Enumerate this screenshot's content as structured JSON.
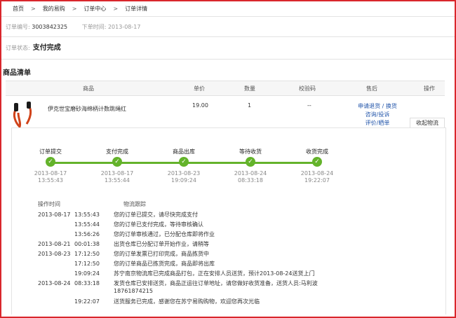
{
  "breadcrumb": [
    "首页",
    "我的易购",
    "订单中心",
    "订单详情"
  ],
  "order": {
    "no_label": "订单编号:",
    "no_value": "3003842325",
    "time_label": "下单时间:",
    "time_value": "2013-08-17",
    "state_label": "订单状态:",
    "state_value": "支付完成"
  },
  "section_title": "商品清单",
  "table_headers": [
    "商品",
    "单价",
    "数量",
    "校验码",
    "售后",
    "操作"
  ],
  "product": {
    "name": "伊克世宝磨砂海绵柄计数跳绳红",
    "price": "19.00",
    "qty": "1",
    "code": "--",
    "links": [
      "申请退货 / 换货",
      "咨询/投诉",
      "评价/晒单"
    ]
  },
  "fold_label": "收起物流",
  "steps": [
    {
      "label": "订单提交",
      "date": "2013-08-17",
      "time": "13:55:43"
    },
    {
      "label": "支付完成",
      "date": "2013-08-17",
      "time": "13:55:44"
    },
    {
      "label": "商品出库",
      "date": "2013-08-23",
      "time": "19:09:24"
    },
    {
      "label": "等待收货",
      "date": "2013-08-24",
      "time": "08:33:18"
    },
    {
      "label": "收货完成",
      "date": "2013-08-24",
      "time": "19:22:07"
    }
  ],
  "log_headers": [
    "操作时间",
    "物流跟踪"
  ],
  "log": [
    {
      "date": "2013-08-17",
      "time": "13:55:43",
      "text": "您的订单已提交，请尽快完成支付"
    },
    {
      "date": "",
      "time": "13:55:44",
      "text": "您的订单已支付完成，等待审核确认"
    },
    {
      "date": "",
      "time": "13:56:26",
      "text": "您的订单审核通过，已分配仓库即将作业"
    },
    {
      "date": "2013-08-21",
      "time": "00:01:38",
      "text": "出货仓库已分配订单开始作业，请稍等"
    },
    {
      "date": "2013-08-23",
      "time": "17:12:50",
      "text": "您的订单发票已打印完成，商品拣货中"
    },
    {
      "date": "",
      "time": "17:12:50",
      "text": "您的订单商品已拣货完成，商品即将出库"
    },
    {
      "date": "",
      "time": "19:09:24",
      "text": "苏宁南京物流库已完成商品打包，正在安排人员送货，预计2013-08-24送货上门"
    },
    {
      "date": "2013-08-24",
      "time": "08:33:18",
      "text": "发货仓库已安排送货，商品正运往订单地址，请您做好收货准备，送货人员:马利波",
      "text2": "18761874215"
    },
    {
      "date": "",
      "time": "19:22:07",
      "text": "送货服务已完成，感谢您在苏宁易购购物，欢迎您再次光临"
    }
  ],
  "colors": {
    "frame": "#d9262c",
    "progress": "#64b32b",
    "link": "#2255aa"
  }
}
